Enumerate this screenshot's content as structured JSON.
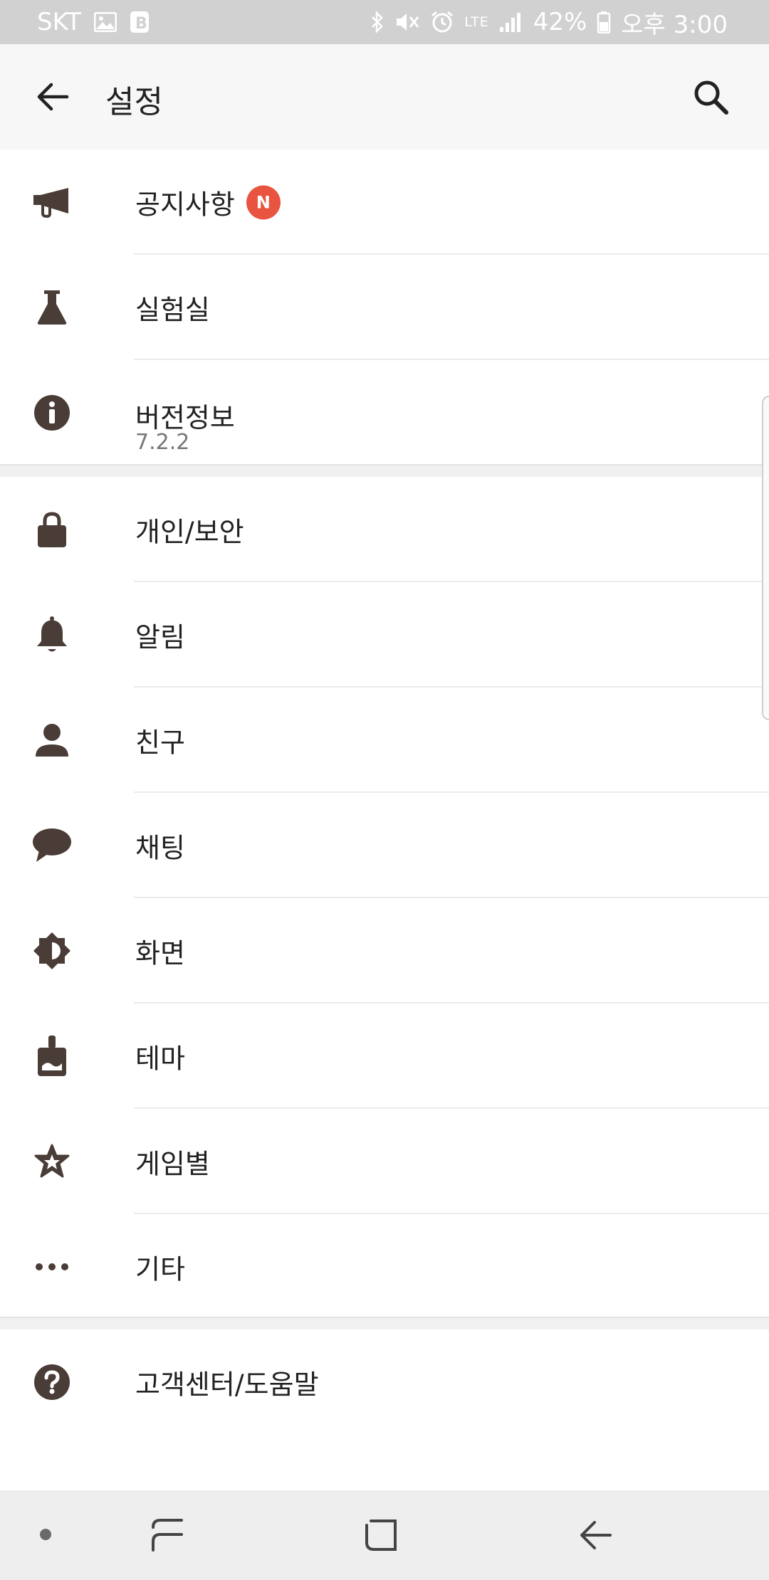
{
  "status_bar": {
    "carrier": "SKT",
    "network": "LTE",
    "battery": "42%",
    "time": "오후 3:00"
  },
  "app_bar": {
    "title": "설정"
  },
  "groups": [
    {
      "items": [
        {
          "label": "공지사항",
          "icon": "megaphone-icon",
          "badge": "N"
        },
        {
          "label": "실험실",
          "icon": "flask-icon"
        },
        {
          "label": "버전정보",
          "icon": "info-icon",
          "sub": "7.2.2"
        }
      ]
    },
    {
      "items": [
        {
          "label": "개인/보안",
          "icon": "lock-icon"
        },
        {
          "label": "알림",
          "icon": "bell-icon"
        },
        {
          "label": "친구",
          "icon": "person-icon"
        },
        {
          "label": "채팅",
          "icon": "chat-bubble-icon"
        },
        {
          "label": "화면",
          "icon": "brightness-icon"
        },
        {
          "label": "테마",
          "icon": "paint-brush-icon"
        },
        {
          "label": "게임별",
          "icon": "star-icon"
        },
        {
          "label": "기타",
          "icon": "more-horizontal-icon"
        }
      ]
    },
    {
      "items": [
        {
          "label": "고객센터/도움말",
          "icon": "help-icon"
        }
      ]
    }
  ],
  "colors": {
    "icon": "#4a3c36",
    "badge": "#e8543f",
    "status_bar": "#d1d1d1",
    "app_bar": "#f7f7f7",
    "nav_bar": "#eeeeee"
  }
}
